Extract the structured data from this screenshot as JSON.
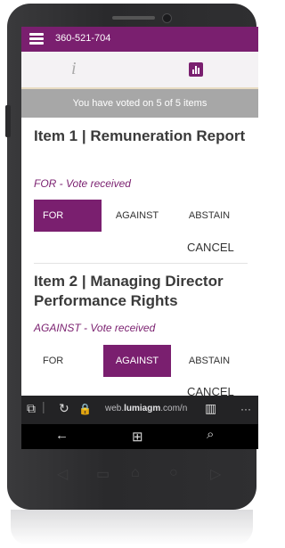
{
  "header": {
    "phone": "360-521-704"
  },
  "tabs": [
    {
      "icon": "info-icon",
      "glyph": "i"
    },
    {
      "icon": "bar-chart-icon"
    }
  ],
  "status": {
    "text": "You have voted on 5 of 5 items"
  },
  "items": [
    {
      "title": "Item 1 | Remuneration Report",
      "status": "FOR - Vote received",
      "buttons": [
        "FOR",
        "AGAINST",
        "ABSTAIN"
      ],
      "selected": "FOR",
      "cancel": "CANCEL"
    },
    {
      "title": "Item 2 | Managing Director Performance Rights",
      "status": "AGAINST - Vote received",
      "buttons": [
        "FOR",
        "AGAINST",
        "ABSTAIN"
      ],
      "selected": "AGAINST",
      "cancel": "CANCEL"
    }
  ],
  "browser": {
    "url_prefix": "web.",
    "url_domain": "lumiagm",
    "url_suffix": ".com/n",
    "more": "···"
  },
  "colors": {
    "accent": "#7a1f6f",
    "status_bar": "#a7a7a7",
    "tab_border": "#e8dcc2"
  }
}
